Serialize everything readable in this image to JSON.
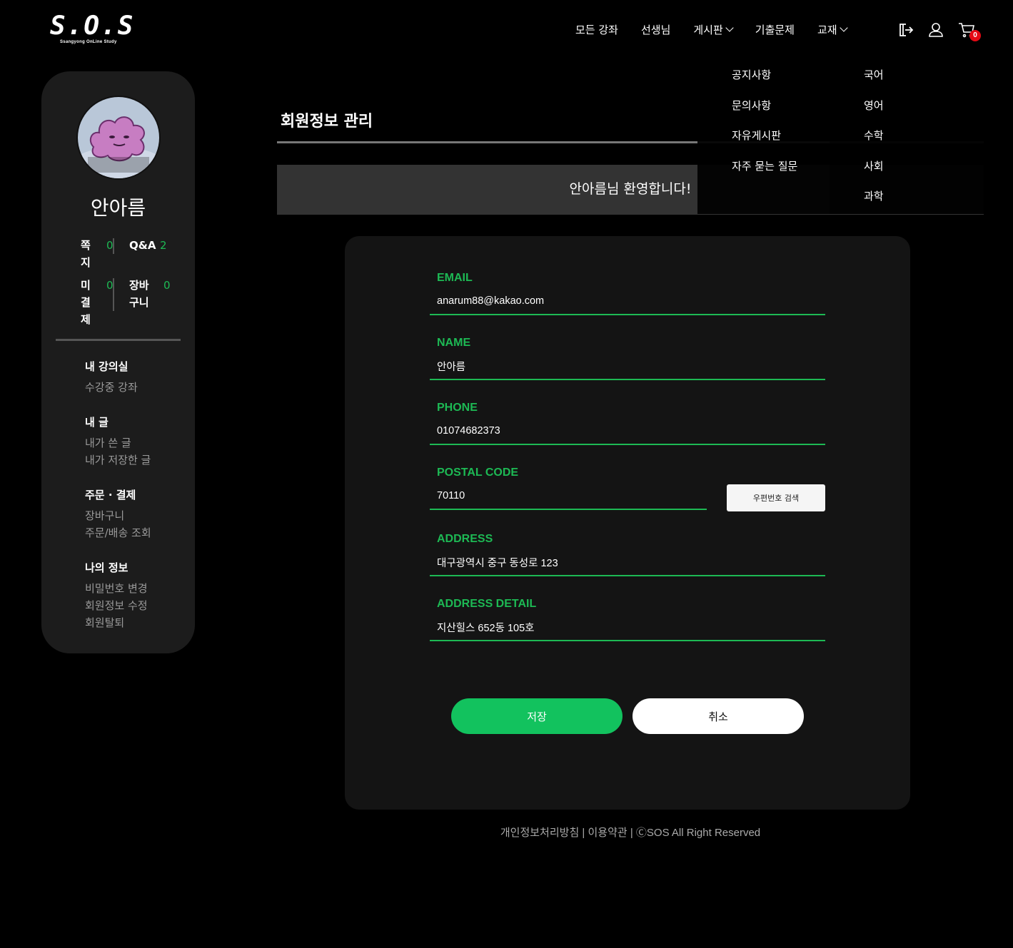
{
  "header": {
    "logo_text": "S.O.S",
    "logo_sub": "Ssangyong OnLine Study",
    "nav": [
      {
        "label": "모든 강좌"
      },
      {
        "label": "선생님"
      },
      {
        "label": "게시판"
      },
      {
        "label": "기출문제"
      },
      {
        "label": "교재"
      }
    ],
    "cart_count": "0",
    "icons": [
      "logout-icon",
      "user-icon",
      "cart-icon"
    ]
  },
  "dropdown": {
    "board": [
      "공지사항",
      "문의사항",
      "자유게시판",
      "자주 묻는 질문"
    ],
    "books": [
      "국어",
      "영어",
      "수학",
      "사회",
      "과학"
    ]
  },
  "sidebar": {
    "username": "안아름",
    "stats": {
      "note_label": "쪽지",
      "note_value": "0",
      "qna_label": "Q&A",
      "qna_value": "2",
      "unpaid_label": "미결제",
      "unpaid_value": "0",
      "cart_label": "장바구니",
      "cart_value": "0"
    },
    "groups": [
      {
        "title": "내 강의실",
        "links": [
          "수강중 강좌"
        ]
      },
      {
        "title": "내 글",
        "links": [
          "내가 쓴 글",
          "내가 저장한 글"
        ]
      },
      {
        "title": "주문 · 결제",
        "links": [
          "장바구니",
          "주문/배송 조회"
        ]
      },
      {
        "title": "나의 정보",
        "links": [
          "비밀번호 변경",
          "회원정보 수정",
          "회원탈퇴"
        ]
      }
    ]
  },
  "main": {
    "title": "회원정보 관리",
    "welcome": "안아름님 환영합니다!",
    "fields": {
      "email_label": "EMAIL",
      "email_value": "anarum88@kakao.com",
      "name_label": "NAME",
      "name_value": "안아름",
      "phone_label": "PHONE",
      "phone_value": "01074682373",
      "postal_label": "POSTAL CODE",
      "postal_value": "70110",
      "address_label": "ADDRESS",
      "address_value": "대구광역시 중구 동성로 123",
      "detail_label": "ADDRESS DETAIL",
      "detail_value": "지산힐스 652동 105호"
    },
    "postal_button": "우편번호 검색",
    "save_button": "저장",
    "cancel_button": "취소"
  },
  "footer": "개인정보처리방침 | 이용약관 | ⒸSOS All Right Reserved",
  "colors": {
    "accent": "#1db954",
    "save": "#12c25e",
    "badge": "#e50914"
  }
}
